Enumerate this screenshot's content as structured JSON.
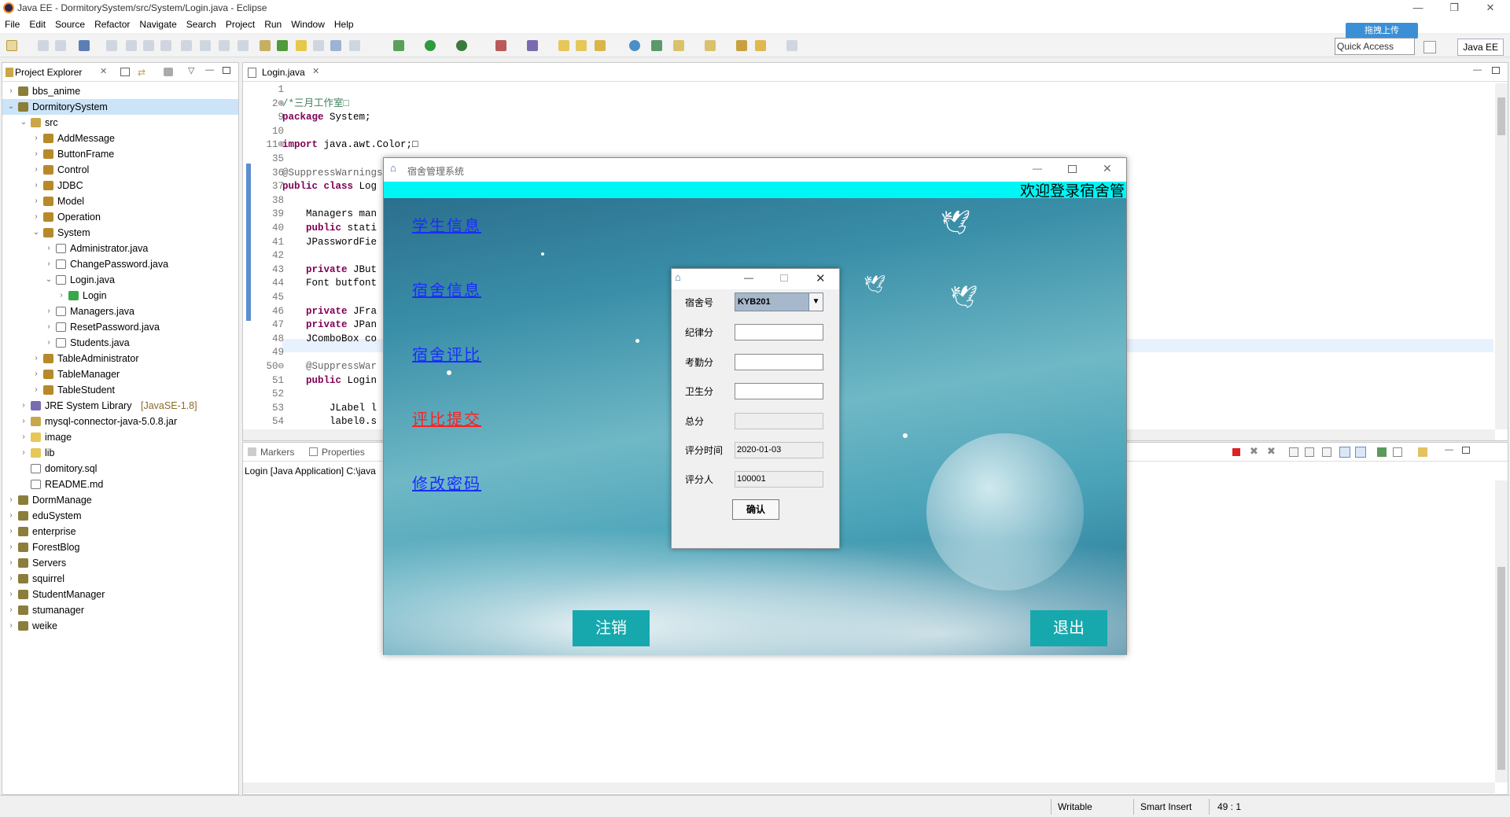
{
  "window": {
    "title": "Java EE - DormitorySystem/src/System/Login.java - Eclipse"
  },
  "menu": [
    "File",
    "Edit",
    "Source",
    "Refactor",
    "Navigate",
    "Search",
    "Project",
    "Run",
    "Window",
    "Help"
  ],
  "quick_access": "Quick Access",
  "perspective": "Java EE",
  "cloud_upload": "拖拽上传",
  "explorer": {
    "tab": "Project Explorer",
    "items": [
      {
        "label": "bbs_anime",
        "depth": 0,
        "arrow": "›",
        "icon": "project"
      },
      {
        "label": "DormitorySystem",
        "depth": 0,
        "arrow": "⌄",
        "icon": "project",
        "selected": true
      },
      {
        "label": "src",
        "depth": 1,
        "arrow": "⌄",
        "icon": "src"
      },
      {
        "label": "AddMessage",
        "depth": 2,
        "arrow": "›",
        "icon": "package"
      },
      {
        "label": "ButtonFrame",
        "depth": 2,
        "arrow": "›",
        "icon": "package"
      },
      {
        "label": "Control",
        "depth": 2,
        "arrow": "›",
        "icon": "package"
      },
      {
        "label": "JDBC",
        "depth": 2,
        "arrow": "›",
        "icon": "package"
      },
      {
        "label": "Model",
        "depth": 2,
        "arrow": "›",
        "icon": "package"
      },
      {
        "label": "Operation",
        "depth": 2,
        "arrow": "›",
        "icon": "package"
      },
      {
        "label": "System",
        "depth": 2,
        "arrow": "⌄",
        "icon": "package"
      },
      {
        "label": "Administrator.java",
        "depth": 3,
        "arrow": "›",
        "icon": "java"
      },
      {
        "label": "ChangePassword.java",
        "depth": 3,
        "arrow": "›",
        "icon": "java"
      },
      {
        "label": "Login.java",
        "depth": 3,
        "arrow": "⌄",
        "icon": "java"
      },
      {
        "label": "Login",
        "depth": 4,
        "arrow": "›",
        "icon": "class"
      },
      {
        "label": "Managers.java",
        "depth": 3,
        "arrow": "›",
        "icon": "java"
      },
      {
        "label": "ResetPassword.java",
        "depth": 3,
        "arrow": "›",
        "icon": "java"
      },
      {
        "label": "Students.java",
        "depth": 3,
        "arrow": "›",
        "icon": "java"
      },
      {
        "label": "TableAdministrator",
        "depth": 2,
        "arrow": "›",
        "icon": "package"
      },
      {
        "label": "TableManager",
        "depth": 2,
        "arrow": "›",
        "icon": "package"
      },
      {
        "label": "TableStudent",
        "depth": 2,
        "arrow": "›",
        "icon": "package"
      },
      {
        "label": "JRE System Library",
        "suffix": "[JavaSE-1.8]",
        "depth": 1,
        "arrow": "›",
        "icon": "lib"
      },
      {
        "label": "mysql-connector-java-5.0.8.jar",
        "depth": 1,
        "arrow": "›",
        "icon": "jar"
      },
      {
        "label": "image",
        "depth": 1,
        "arrow": "›",
        "icon": "folder"
      },
      {
        "label": "lib",
        "depth": 1,
        "arrow": "›",
        "icon": "folder"
      },
      {
        "label": "domitory.sql",
        "depth": 1,
        "arrow": "",
        "icon": "file"
      },
      {
        "label": "README.md",
        "depth": 1,
        "arrow": "",
        "icon": "file"
      },
      {
        "label": "DormManage",
        "depth": 0,
        "arrow": "›",
        "icon": "project"
      },
      {
        "label": "eduSystem",
        "depth": 0,
        "arrow": "›",
        "icon": "project"
      },
      {
        "label": "enterprise",
        "depth": 0,
        "arrow": "›",
        "icon": "project"
      },
      {
        "label": "ForestBlog",
        "depth": 0,
        "arrow": "›",
        "icon": "project"
      },
      {
        "label": "Servers",
        "depth": 0,
        "arrow": "›",
        "icon": "project"
      },
      {
        "label": "squirrel",
        "depth": 0,
        "arrow": "›",
        "icon": "project"
      },
      {
        "label": "StudentManager",
        "depth": 0,
        "arrow": "›",
        "icon": "project"
      },
      {
        "label": "stumanager",
        "depth": 0,
        "arrow": "›",
        "icon": "project"
      },
      {
        "label": "weike",
        "depth": 0,
        "arrow": "›",
        "icon": "project"
      }
    ]
  },
  "editor": {
    "tab": "Login.java",
    "lines": [
      {
        "n": "1",
        "t": ""
      },
      {
        "n": "2⊕",
        "t": "/*三月工作室□",
        "cls": "cm"
      },
      {
        "n": "9",
        "t": "package System;",
        "kw": "package"
      },
      {
        "n": "10",
        "t": ""
      },
      {
        "n": "11⊕",
        "t": "import java.awt.Color;□",
        "kw": "import"
      },
      {
        "n": "35",
        "t": ""
      },
      {
        "n": "36",
        "t": "@SuppressWarnings",
        "cls": "an"
      },
      {
        "n": "37",
        "t": "public class Log",
        "kw": "public class"
      },
      {
        "n": "38",
        "t": ""
      },
      {
        "n": "39",
        "t": "    Managers man"
      },
      {
        "n": "40",
        "t": "    public stati",
        "kw": "public"
      },
      {
        "n": "41",
        "t": "    JPasswordFie"
      },
      {
        "n": "42",
        "t": ""
      },
      {
        "n": "43",
        "t": "    private JBut",
        "kw": "private"
      },
      {
        "n": "44",
        "t": "    Font butfont"
      },
      {
        "n": "45",
        "t": ""
      },
      {
        "n": "46",
        "t": "    private JFra",
        "kw": "private"
      },
      {
        "n": "47",
        "t": "    private JPan",
        "kw": "private"
      },
      {
        "n": "48",
        "t": "    JComboBox co"
      },
      {
        "n": "49",
        "t": ""
      },
      {
        "n": "50⊖",
        "t": "    @SuppressWar",
        "cls": "an"
      },
      {
        "n": "51",
        "t": "    public Login",
        "kw": "public"
      },
      {
        "n": "52",
        "t": ""
      },
      {
        "n": "53",
        "t": "        JLabel l"
      },
      {
        "n": "54",
        "t": "        label0.s"
      }
    ]
  },
  "console": {
    "tabs": [
      "Markers",
      "Properties"
    ],
    "line": "Login [Java Application] C:\\java"
  },
  "status": {
    "writable": "Writable",
    "mode": "Smart Insert",
    "pos": "49 : 1"
  },
  "app": {
    "title": "宿舍管理系统",
    "banner": "欢迎登录宿舍管",
    "nav": [
      {
        "label": "学生信息",
        "color": "#1a2dff"
      },
      {
        "label": "宿舍信息",
        "color": "#1a2dff"
      },
      {
        "label": "宿舍评比",
        "color": "#1a2dff"
      },
      {
        "label": "评比提交",
        "color": "#ff2020"
      },
      {
        "label": "修改密码",
        "color": "#1a2dff"
      }
    ],
    "logout": "注销",
    "exit": "退出"
  },
  "dialog": {
    "dorm_label": "宿舍号",
    "dorm_value": "KYB201",
    "discipline_label": "纪律分",
    "attendance_label": "考勤分",
    "hygiene_label": "卫生分",
    "total_label": "总分",
    "time_label": "评分时间",
    "time_value": "2020-01-03",
    "rater_label": "评分人",
    "rater_value": "100001",
    "confirm": "确认"
  }
}
